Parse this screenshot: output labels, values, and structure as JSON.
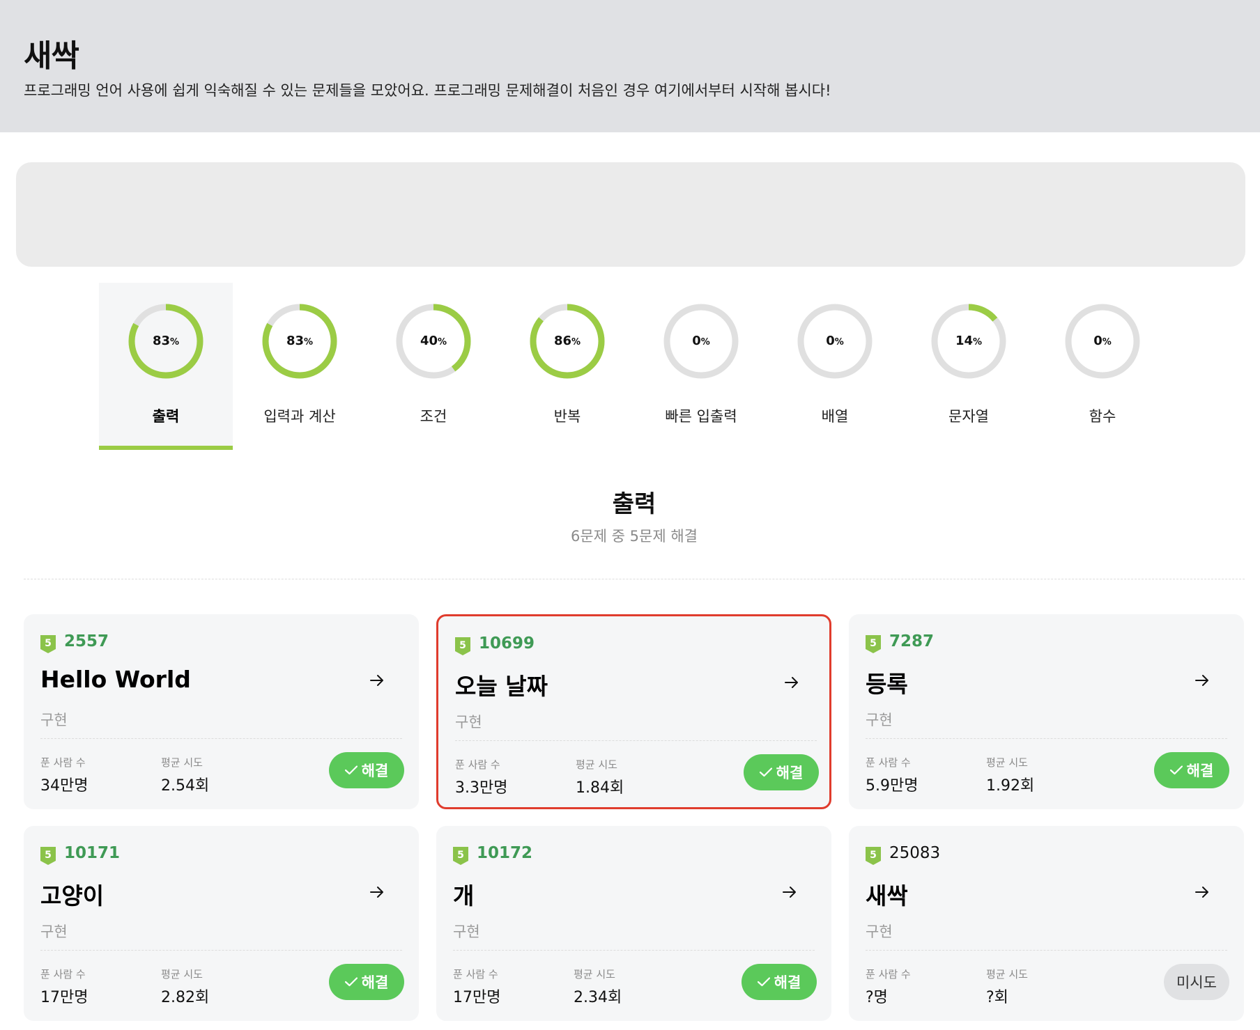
{
  "header": {
    "title": "새싹",
    "description": "프로그래밍 언어 사용에 쉽게 익숙해질 수 있는 문제들을 모았어요. 프로그래밍 문제해결이 처음인 경우 여기에서부터 시작해 봅시다!"
  },
  "categories": [
    {
      "label": "출력",
      "percent": 83,
      "percent_text": "83",
      "active": true
    },
    {
      "label": "입력과 계산",
      "percent": 83,
      "percent_text": "83",
      "active": false
    },
    {
      "label": "조건",
      "percent": 40,
      "percent_text": "40",
      "active": false
    },
    {
      "label": "반복",
      "percent": 86,
      "percent_text": "86",
      "active": false
    },
    {
      "label": "빠른 입출력",
      "percent": 0,
      "percent_text": "0",
      "active": false
    },
    {
      "label": "배열",
      "percent": 0,
      "percent_text": "0",
      "active": false
    },
    {
      "label": "문자열",
      "percent": 14,
      "percent_text": "14",
      "active": false
    },
    {
      "label": "함수",
      "percent": 0,
      "percent_text": "0",
      "active": false
    }
  ],
  "percent_sign": "%",
  "section": {
    "title": "출력",
    "subtitle": "6문제 중 5문제 해결"
  },
  "stat_labels": {
    "solvers": "푼 사람 수",
    "avg_attempts": "평균 시도"
  },
  "tier_label": "5",
  "problems": [
    {
      "id": "2557",
      "title": "Hello World",
      "type": "구현",
      "solvers": "34만명",
      "avg": "2.54회",
      "status": "해결",
      "solved": true
    },
    {
      "id": "10699",
      "title": "오늘 날짜",
      "type": "구현",
      "solvers": "3.3만명",
      "avg": "1.84회",
      "status": "해결",
      "solved": true
    },
    {
      "id": "7287",
      "title": "등록",
      "type": "구현",
      "solvers": "5.9만명",
      "avg": "1.92회",
      "status": "해결",
      "solved": true
    },
    {
      "id": "10171",
      "title": "고양이",
      "type": "구현",
      "solvers": "17만명",
      "avg": "2.82회",
      "status": "해결",
      "solved": true
    },
    {
      "id": "10172",
      "title": "개",
      "type": "구현",
      "solvers": "17만명",
      "avg": "2.34회",
      "status": "해결",
      "solved": true
    },
    {
      "id": "25083",
      "title": "새싹",
      "type": "구현",
      "solvers": "?명",
      "avg": "?회",
      "status": "미시도",
      "solved": false
    }
  ],
  "colors": {
    "progress": "#9bcc45",
    "track": "#e0e0e0",
    "solved_badge": "#5bc95a",
    "highlight_border": "#e03c2d",
    "tier_green": "#8bc34a"
  }
}
